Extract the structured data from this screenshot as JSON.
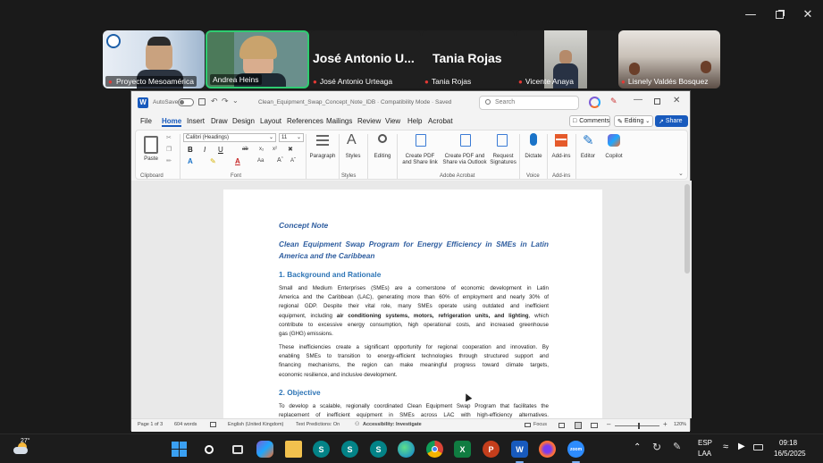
{
  "zoom": {
    "participants": [
      {
        "name": "Proyecto Mesoamérica"
      },
      {
        "name": "Andrea Heins"
      },
      {
        "name": "José Antonio Urteaga",
        "display_short": "José Antonio U..."
      },
      {
        "name": "Tania Rojas"
      },
      {
        "name": "Vicente Anaya"
      },
      {
        "name": "Lisnely Valdés Bosquez"
      }
    ],
    "active_speaker_color": "#2ecc71"
  },
  "word": {
    "autosave_label": "AutoSave",
    "title": "Clean_Equipment_Swap_Concept_Note_IDB · Compatibility Mode · Saved",
    "search_placeholder": "Search",
    "menus": [
      "File",
      "Home",
      "Insert",
      "Draw",
      "Design",
      "Layout",
      "References",
      "Mailings",
      "Review",
      "View",
      "Help",
      "Acrobat"
    ],
    "active_menu": "Home",
    "comments_label": "Comments",
    "editing_label": "Editing",
    "share_label": "Share",
    "font_name": "Calibri (Headings)",
    "font_size": "11",
    "ribbon": {
      "paste": "Paste",
      "paragraph": "Paragraph",
      "styles": "Styles",
      "editing": "Editing",
      "create_pdf_share_link": "Create PDF and Share link",
      "create_pdf_share_outlook": "Create PDF and Share via Outlook",
      "request_signatures": "Request Signatures",
      "dictate": "Dictate",
      "addins": "Add-ins",
      "editor": "Editor",
      "copilot": "Copilot",
      "groups": {
        "clipboard": "Clipboard",
        "font": "Font",
        "styles": "Styles",
        "adobe": "Adobe Acrobat",
        "voice": "Voice",
        "addins": "Add-ins"
      }
    },
    "status": {
      "page": "Page 1 of 3",
      "words": "604 words",
      "language": "English (United Kingdom)",
      "text_predictions": "Text Predictions: On",
      "accessibility": "Accessibility: Investigate",
      "focus": "Focus",
      "zoom": "120%"
    },
    "brand_color": "#185abd"
  },
  "document": {
    "doc_title": "Concept Note",
    "subtitle_line1": "Clean Equipment Swap Program for Energy Efficiency in SMEs in Latin",
    "subtitle_line2": "America and the Caribbean",
    "section1": "1. Background and Rationale",
    "p1_l1": "Small and Medium Enterprises (SMEs) are a cornerstone of economic development in Latin",
    "p1_l2": "America and the Caribbean (LAC), generating more than 60% of employment and nearly 30% of",
    "p1_l3": "regional GDP. Despite their vital role, many SMEs operate using outdated and inefficient",
    "p1_l4a": "equipment, including ",
    "p1_l4b": "air conditioning systems, motors, refrigeration units, and lighting",
    "p1_l4c": ", which",
    "p1_l5": "contribute to excessive energy consumption, high operational costs, and increased greenhouse",
    "p1_l6": "gas (GHG) emissions.",
    "p2_l1": "These inefficiencies create a significant opportunity for regional cooperation and innovation. By",
    "p2_l2": "enabling SMEs to transition to energy-efficient technologies through structured support and",
    "p2_l3": "financing mechanisms, the region can make meaningful progress toward climate targets,",
    "p2_l4": "economic resilience, and inclusive development.",
    "section2": "2. Objective",
    "p3_l1": "To develop a scalable, regionally coordinated Clean Equipment Swap Program that facilitates the",
    "p3_l2": "replacement of inefficient equipment in SMEs across LAC with high-efficiency alternatives."
  },
  "taskbar": {
    "weather": "27°",
    "lang1": "ESP",
    "lang2": "LAA",
    "time": "09:18",
    "date": "16/5/2025"
  }
}
